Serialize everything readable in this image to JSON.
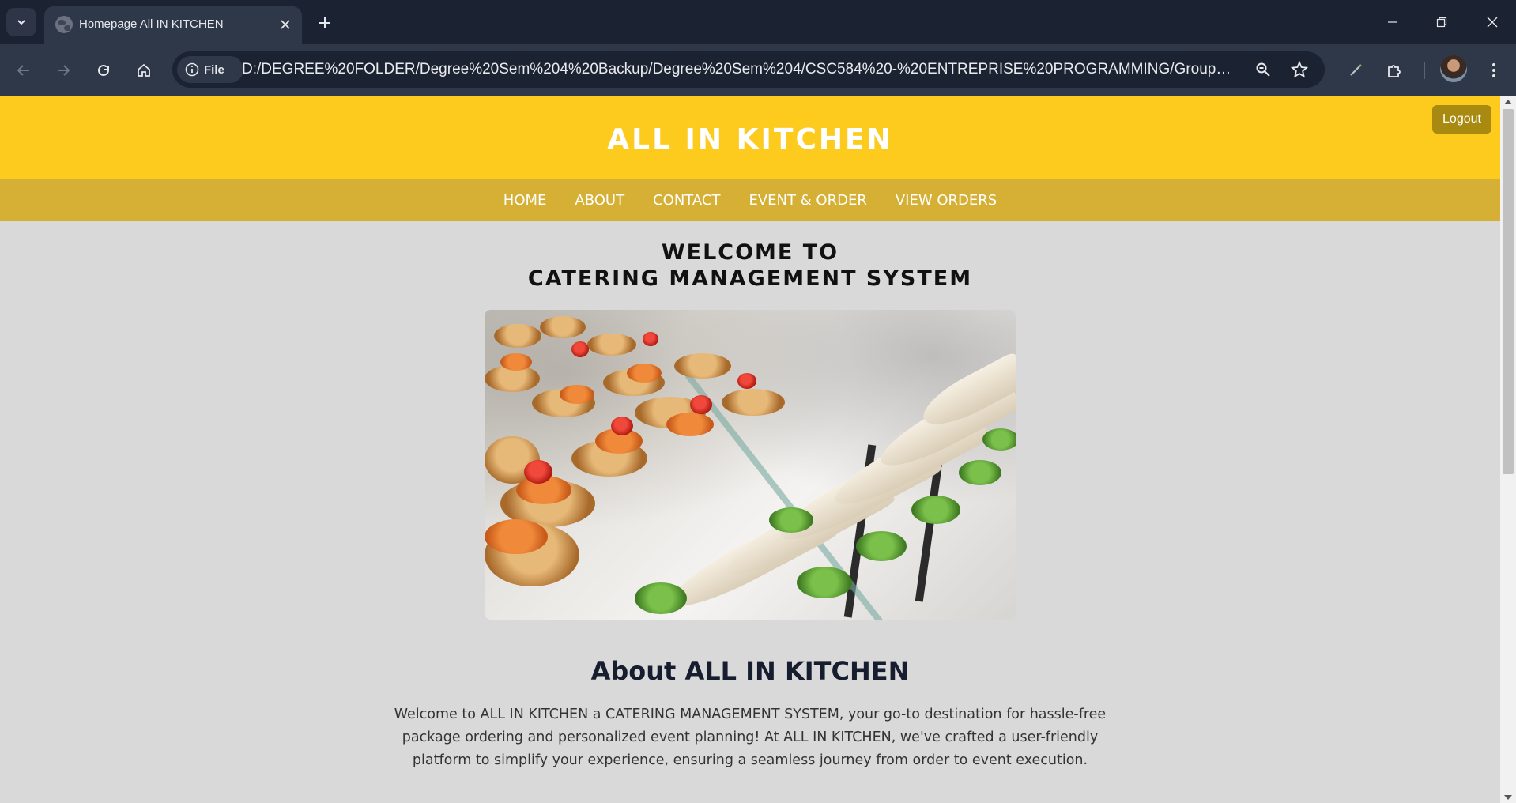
{
  "browser": {
    "tab_title": "Homepage All IN KITCHEN",
    "site_chip_label": "File",
    "url": "D:/DEGREE%20FOLDER/Degree%20Sem%204%20Backup/Degree%20Sem%204/CSC584%20-%20ENTREPRISE%20PROGRAMMING/Group%20As..."
  },
  "header": {
    "brand": "ALL IN KITCHEN",
    "logout_label": "Logout"
  },
  "nav": {
    "items": [
      {
        "label": "HOME"
      },
      {
        "label": "ABOUT"
      },
      {
        "label": "CONTACT"
      },
      {
        "label": "EVENT & ORDER"
      },
      {
        "label": "VIEW ORDERS"
      }
    ]
  },
  "welcome": {
    "line1": "WELCOME TO",
    "line2": "CATERING MANAGEMENT SYSTEM"
  },
  "about": {
    "title": "About ALL IN KITCHEN",
    "text": "Welcome to ALL IN KITCHEN a CATERING MANAGEMENT SYSTEM, your go-to destination for hassle-free package ordering and personalized event planning! At ALL IN KITCHEN, we've crafted a user-friendly platform to simplify your experience, ensuring a seamless journey from order to event execution."
  },
  "colors": {
    "header_bg": "#fccb1e",
    "nav_bg": "#d6b035",
    "logout_bg": "#a88a10",
    "page_bg": "#d9d9d9",
    "chrome_bg": "#1b2231"
  },
  "icons": {
    "tab_menu": "chevron-down-icon",
    "tab_favicon": "globe-icon",
    "tab_close": "close-icon",
    "new_tab": "plus-icon",
    "back": "arrow-left-icon",
    "forward": "arrow-right-icon",
    "reload": "reload-icon",
    "home": "home-icon",
    "site_info": "info-icon",
    "zoom": "zoom-icon",
    "bookmark": "star-icon",
    "pen": "pen-icon",
    "extensions": "puzzle-icon",
    "menu": "more-vertical-icon"
  }
}
